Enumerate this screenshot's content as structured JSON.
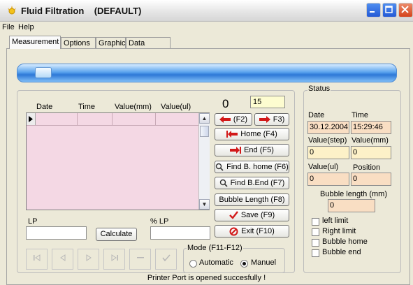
{
  "window": {
    "title": "Fluid Filtration    (DEFAULT)"
  },
  "menu": [
    "File",
    "Help"
  ],
  "tabs": [
    "Measurement",
    "Options",
    "Graphic",
    "Data Merge"
  ],
  "progress": {
    "value_fraction": 0.0
  },
  "table": {
    "columns": [
      "Date",
      "Time",
      "Value(mm)",
      "Value(ul)"
    ]
  },
  "counter": {
    "value": "0",
    "input_value": "15"
  },
  "buttons": {
    "prev": "(F2)",
    "next": "F3)",
    "home": "Home (F4)",
    "end": "End (F5)",
    "find_home": "Find B. home (F6)",
    "find_end": "Find B.End (F7)",
    "bubble_length": "Bubble Length (F8)",
    "save": "Save (F9)",
    "exit": "Exit (F10)",
    "calculate": "Calculate"
  },
  "lp": {
    "label": "LP",
    "value": "",
    "pct_label": "% LP",
    "pct_value": ""
  },
  "mode": {
    "legend": "Mode (F11-F12)",
    "options": [
      "Automatic",
      "Manuel"
    ],
    "selected": "Manuel"
  },
  "status": {
    "legend": "Status",
    "date_label": "Date",
    "date_value": "30.12.2004",
    "time_label": "Time",
    "time_value": "15:29:46",
    "value_step_label": "Value(step)",
    "value_step": "0",
    "value_mm_label": "Value(mm)",
    "value_mm": "0",
    "value_ul_label": "Value(ul)",
    "value_ul": "0",
    "position_label": "Position",
    "position": "0",
    "bubble_length_label": "Bubble length (mm)",
    "bubble_length": "0",
    "checks": [
      "left limit",
      "Right limit",
      "Bubble home",
      "Bubble end"
    ]
  },
  "statusbar": {
    "text": "Printer Port is opened succesfully !"
  },
  "colors": {
    "grid_background": "#f4d8e4",
    "yellow_field": "#fdf1c8",
    "peach_field": "#f9dec3",
    "arrow_red": "#d21818",
    "progress_blue": "#2d78d6"
  }
}
